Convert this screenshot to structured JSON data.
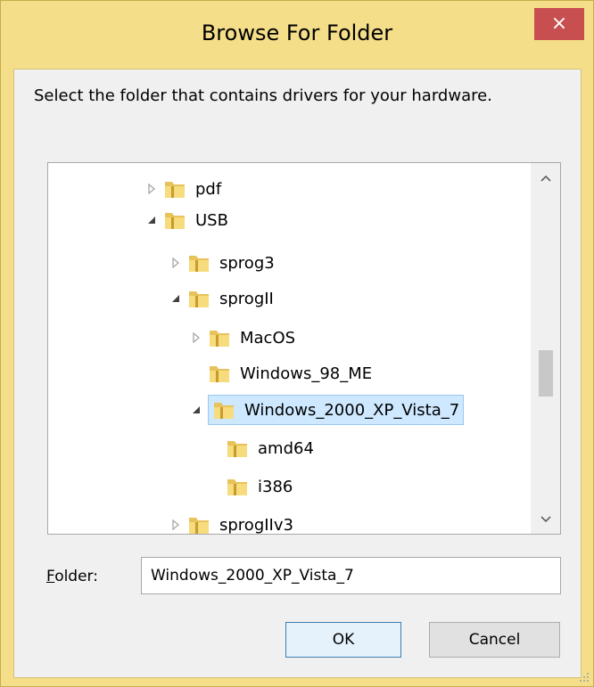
{
  "window": {
    "title": "Browse For Folder",
    "close_glyph": "×"
  },
  "instruction": "Select the folder that contains drivers for your hardware.",
  "tree": {
    "items": [
      {
        "label": "pdf",
        "state": "collapsed"
      },
      {
        "label": "USB",
        "state": "expanded"
      },
      {
        "label": "sprog3",
        "state": "collapsed"
      },
      {
        "label": "sprogII",
        "state": "expanded"
      },
      {
        "label": "MacOS",
        "state": "collapsed"
      },
      {
        "label": "Windows_98_ME",
        "state": "leaf"
      },
      {
        "label": "Windows_2000_XP_Vista_7",
        "state": "expanded",
        "selected": true
      },
      {
        "label": "amd64",
        "state": "leaf"
      },
      {
        "label": "i386",
        "state": "leaf"
      },
      {
        "label": "sprogIIv3",
        "state": "collapsed"
      }
    ]
  },
  "folder_field": {
    "label_underlined": "F",
    "label_rest": "older:",
    "value": "Windows_2000_XP_Vista_7"
  },
  "buttons": {
    "ok": "OK",
    "cancel": "Cancel"
  },
  "colors": {
    "frame": "#f4de89",
    "close": "#c74f4f",
    "selection": "#cde8ff"
  }
}
